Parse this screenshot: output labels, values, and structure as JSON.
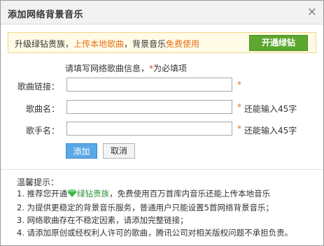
{
  "dialog": {
    "title": "添加网络背景音乐",
    "close_symbol": "×"
  },
  "promo": {
    "text_prefix": "升级绿钻贵族，",
    "text_upload": "上传本地歌曲",
    "text_middle": "，背景音乐",
    "text_free": "免费使用",
    "button_label": "开通绿钻",
    "accent_color": "#e8701a",
    "button_color": "#5da62f"
  },
  "info": {
    "text": "请填写网络歌曲信息，",
    "required_mark": "*",
    "required_text": "为必填项"
  },
  "form": {
    "link": {
      "label": "歌曲链接：",
      "value": "",
      "required": "*"
    },
    "song": {
      "label": "歌曲名：",
      "value": "",
      "required": "*",
      "hint": "还能输入45字"
    },
    "singer": {
      "label": "歌手名：",
      "value": "",
      "required": "*",
      "hint": "还能输入45字"
    }
  },
  "actions": {
    "add_label": "添加",
    "cancel_label": "取消"
  },
  "tips": {
    "title": "温馨提示：",
    "item1_prefix": "1. 推荐您开通",
    "item1_link": "绿钻贵族",
    "item1_suffix": "，免费使用百万首库内音乐还能上传本地音乐",
    "item2": "2. 为提供更稳定的背景音乐服务，普通用户只能设置5首网络背景音乐；",
    "item3": "3. 网络歌曲存在不稳定因素，请添加完整链接；",
    "item4": "4. 请添加原创或经权利人许可的歌曲，腾讯公司对相关版权问题不承担负责。"
  }
}
